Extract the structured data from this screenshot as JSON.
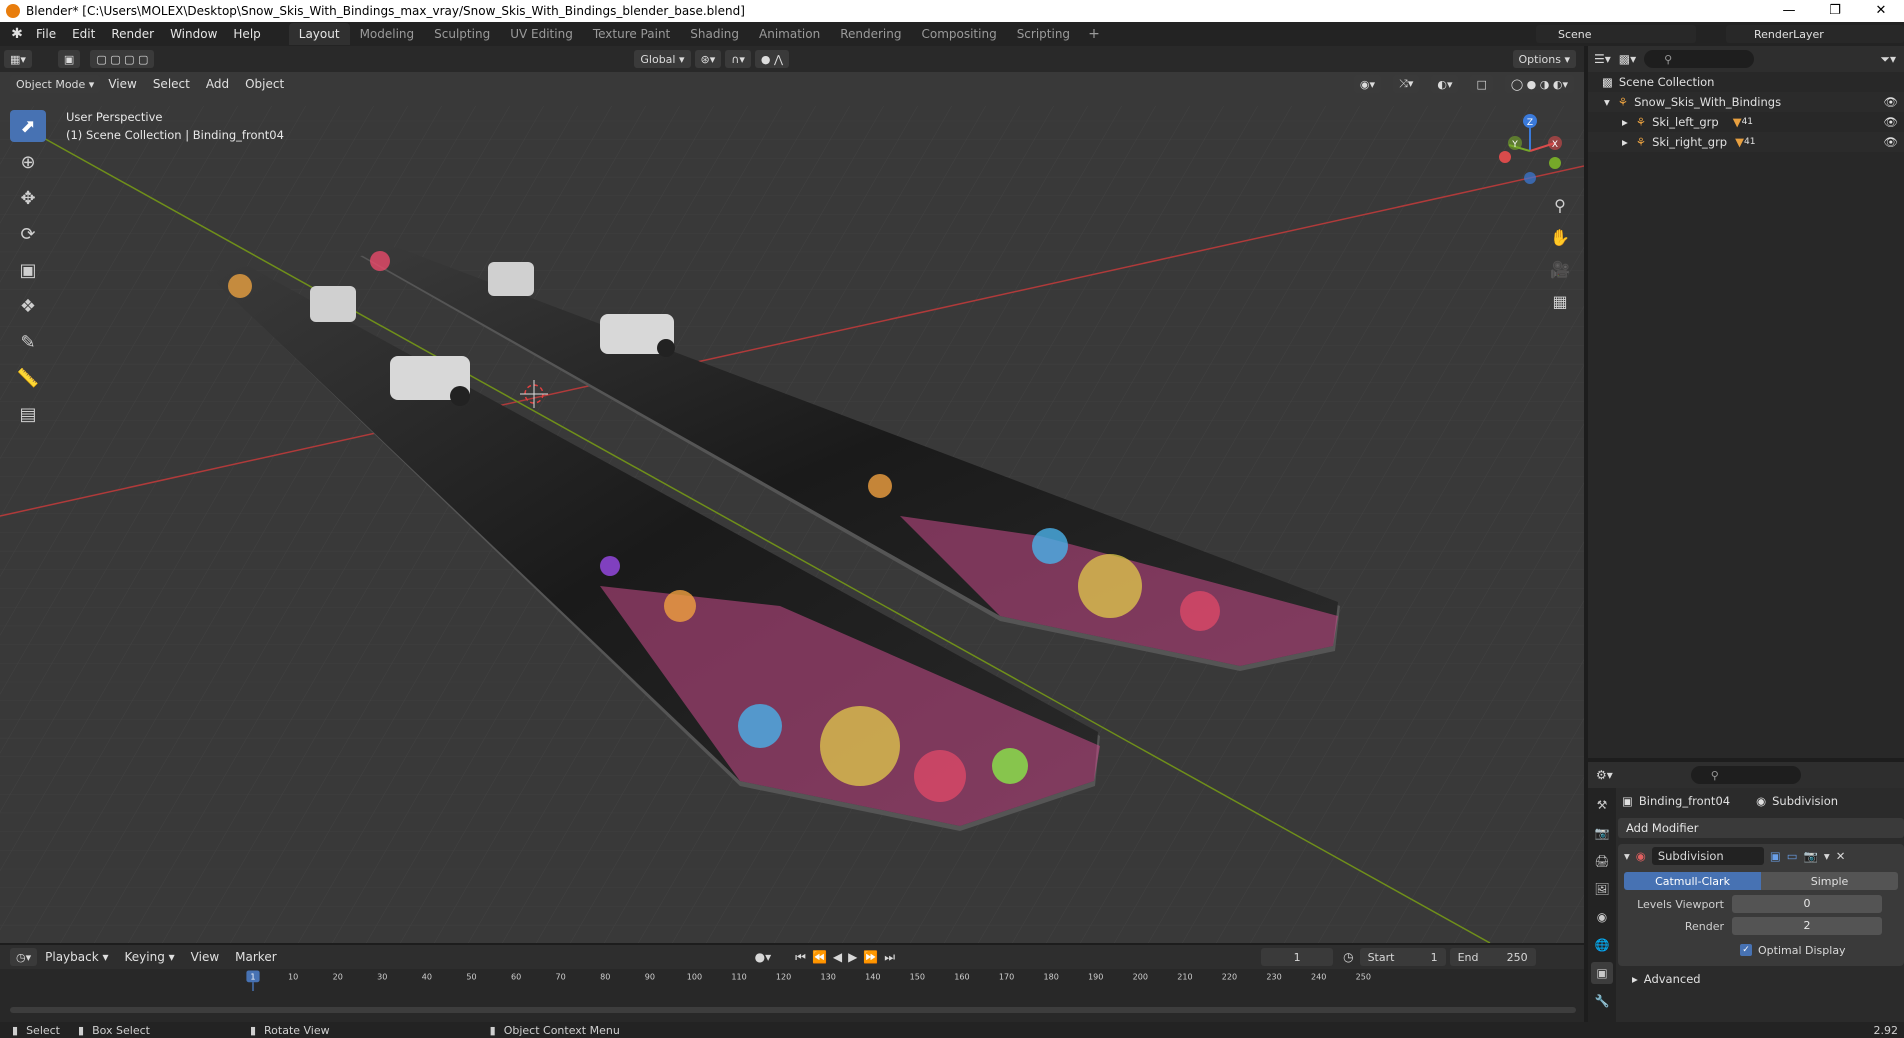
{
  "window": {
    "title": "Blender* [C:\\Users\\MOLEX\\Desktop\\Snow_Skis_With_Bindings_max_vray/Snow_Skis_With_Bindings_blender_base.blend]",
    "controls": [
      "—",
      "❐",
      "✕"
    ]
  },
  "menu": [
    "File",
    "Edit",
    "Render",
    "Window",
    "Help"
  ],
  "workspaces": [
    "Layout",
    "Modeling",
    "Sculpting",
    "UV Editing",
    "Texture Paint",
    "Shading",
    "Animation",
    "Rendering",
    "Compositing",
    "Scripting"
  ],
  "workspace_active": "Layout",
  "scene_name": "Scene",
  "render_layer": "RenderLayer",
  "viewport": {
    "transform_orientation": "Global",
    "options_label": "Options",
    "mode": "Object Mode",
    "header_menus": [
      "View",
      "Select",
      "Add",
      "Object"
    ],
    "perspective": "User Perspective",
    "collection_info": "(1) Scene Collection | Binding_front04",
    "axes": {
      "x": "X",
      "y": "Y",
      "z": "Z"
    }
  },
  "outliner": {
    "root": "Scene Collection",
    "items": [
      {
        "label": "Snow_Skis_With_Bindings",
        "depth": 1
      },
      {
        "label": "Ski_left_grp",
        "depth": 2,
        "badge": "41"
      },
      {
        "label": "Ski_right_grp",
        "depth": 2,
        "badge": "41"
      }
    ]
  },
  "properties": {
    "object_name": "Binding_front04",
    "modifier_crumb": "Subdivision",
    "add_modifier": "Add Modifier",
    "modifier": {
      "name": "Subdivision",
      "type_options": [
        "Catmull-Clark",
        "Simple"
      ],
      "type_selected": "Catmull-Clark",
      "levels_viewport_label": "Levels Viewport",
      "levels_viewport": "0",
      "render_label": "Render",
      "render_levels": "2",
      "optimal_display_label": "Optimal Display",
      "optimal_display": true,
      "advanced_label": "Advanced"
    }
  },
  "timeline": {
    "menus": [
      "Playback",
      "Keying",
      "View",
      "Marker"
    ],
    "current_frame": "1",
    "start_label": "Start",
    "start": "1",
    "end_label": "End",
    "end": "250",
    "ticks": [
      "1",
      "10",
      "20",
      "30",
      "40",
      "50",
      "60",
      "70",
      "80",
      "90",
      "100",
      "110",
      "120",
      "130",
      "140",
      "150",
      "160",
      "170",
      "180",
      "190",
      "200",
      "210",
      "220",
      "230",
      "240",
      "250"
    ]
  },
  "statusbar": {
    "select": "Select",
    "box_select": "Box Select",
    "rotate": "Rotate View",
    "context_menu": "Object Context Menu",
    "version": "2.92"
  },
  "colors": {
    "accent": "#4772b3",
    "viewport_bg": "#393939",
    "axis_x": "#c64040",
    "axis_y": "#7a9a1c"
  }
}
